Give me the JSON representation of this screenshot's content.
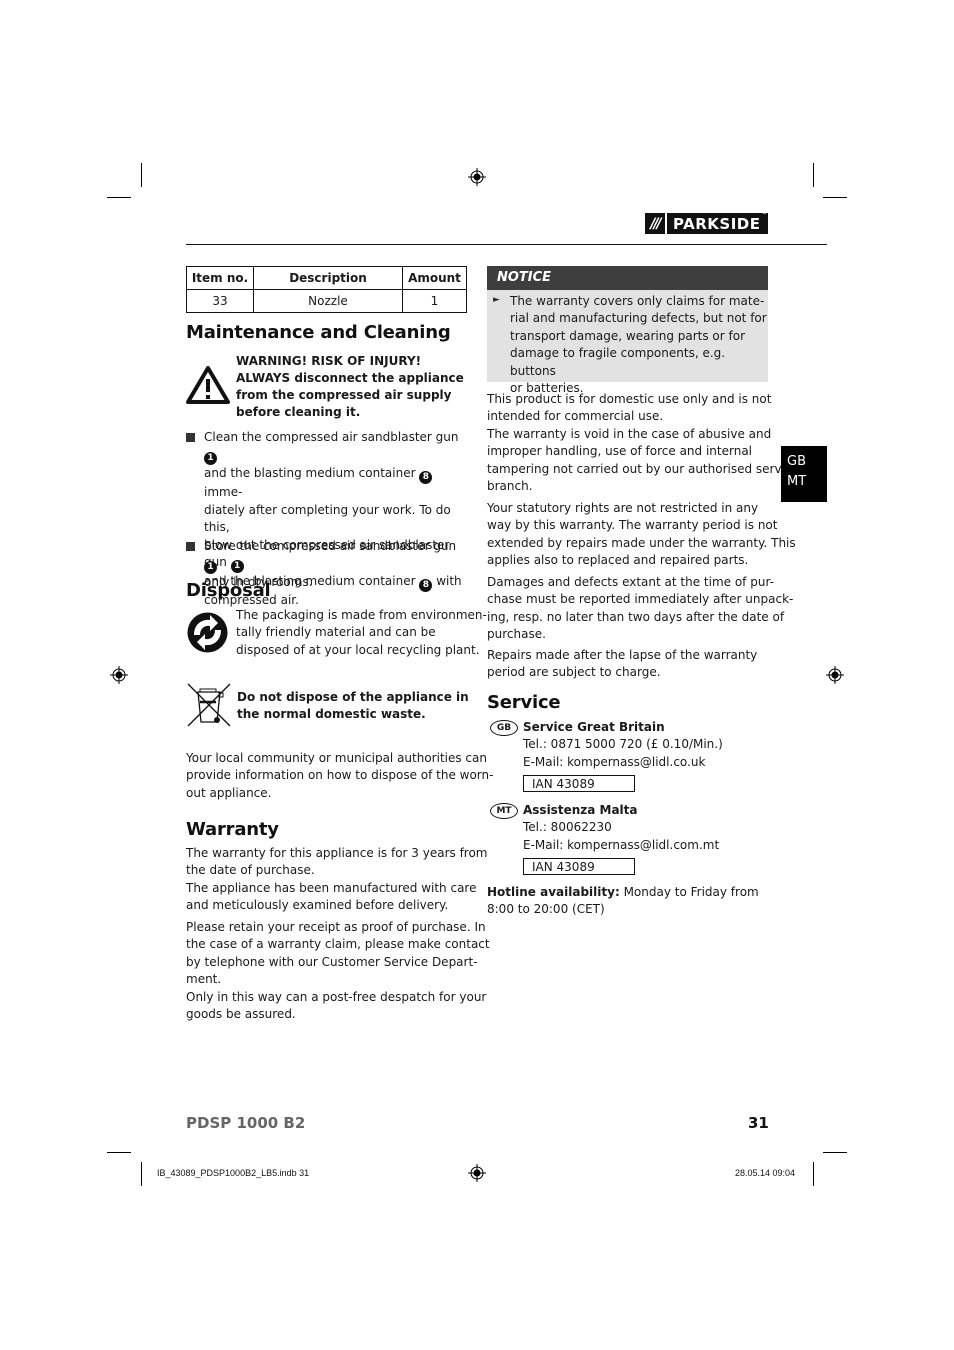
{
  "header": {
    "brand": "PARKSIDE",
    "brand_slashes": "///",
    "brand_registered": "®"
  },
  "parts_table": {
    "columns": [
      "Item no.",
      "Description",
      "Amount"
    ],
    "rows": [
      [
        "33",
        "Nozzle",
        "1"
      ]
    ]
  },
  "maintenance": {
    "title": "Maintenance and Cleaning",
    "warning_lines": [
      "WARNING! RISK OF INJURY!",
      "ALWAYS disconnect the appliance",
      "from the compressed air supply",
      "before cleaning it."
    ],
    "bullet1": {
      "lines": [
        "Clean the compressed air sandblaster gun",
        "and the blasting medium container",
        "imme-",
        "diately after completing your work. To do this,",
        "blow out the compressed air sandblaster gun",
        "and the blasting medium container",
        "with",
        "compressed air."
      ],
      "ref_gun": "1",
      "ref_container": "8"
    },
    "bullet2": {
      "lines": [
        "Store the compressed air sandblaster gun",
        "only in dry rooms."
      ],
      "ref_gun": "1"
    }
  },
  "disposal": {
    "title": "Disposal",
    "packaging_lines": [
      "The packaging is made from environmen-",
      "tally friendly material and can be",
      "disposed of at your local recycling plant."
    ],
    "weee_lines": [
      "Do not dispose of the appliance in",
      "the normal domestic waste."
    ],
    "info_lines": [
      "Your local community or municipal authorities can",
      "provide information on how to dispose of the worn-",
      "out appliance."
    ]
  },
  "warranty": {
    "title": "Warranty",
    "para1": [
      "The warranty for this appliance is for 3 years from",
      "the date of purchase.",
      "The appliance has been manufactured with care",
      "and meticulously examined before delivery."
    ],
    "para2": [
      "Please retain your receipt as proof of purchase. In",
      "the case of a warranty claim, please make contact",
      "by telephone with our Customer Service Depart-",
      "ment.",
      "Only in this way can a post-free despatch for your",
      "goods be assured."
    ]
  },
  "notice": {
    "title": "NOTICE",
    "lines": [
      "The warranty covers only claims for mate-",
      "rial and manufacturing defects, but not for",
      "transport damage, wearing parts or for",
      "damage to fragile components, e.g. buttons",
      "or batteries."
    ]
  },
  "right_col": {
    "para1": [
      "This product is for domestic use only and is not",
      "intended for commercial use.",
      "The warranty is void in the case of abusive and",
      "improper handling, use of force and internal",
      "tampering not carried out by our authorised service",
      "branch."
    ],
    "para2": [
      "Your statutory rights are not restricted in any",
      "way by this warranty. The warranty period is not",
      "extended by repairs made under the warranty. This",
      "applies also to replaced and repaired parts."
    ],
    "para3": [
      "Damages and defects extant at the time of pur-",
      "chase must be reported immediately after unpack-",
      "ing, resp. no later than two days after the date of",
      "purchase."
    ],
    "para4": [
      "Repairs made after the lapse of the warranty",
      "period are subject to charge."
    ]
  },
  "service": {
    "title": "Service",
    "gb": {
      "code": "GB",
      "name": "Service Great Britain",
      "tel": "Tel.: 0871 5000 720 (£ 0.10/Min.)",
      "email": "E-Mail: kompernass@lidl.co.uk",
      "ian": "IAN 43089"
    },
    "mt": {
      "code": "MT",
      "name": "Assistenza Malta",
      "tel": "Tel.: 80062230",
      "email": "E-Mail: kompernass@lidl.com.mt",
      "ian": "IAN 43089"
    },
    "hotline_label": "Hotline availability:",
    "hotline_text": " Monday to Friday from",
    "hotline_text2": "8:00 to 20:00 (CET)"
  },
  "side_tab": {
    "line1": "GB",
    "line2": "MT"
  },
  "footer": {
    "model": "PDSP 1000 B2",
    "page": "31",
    "slug_file": "IB_43089_PDSP1000B2_LB5.indb   31",
    "slug_date": "28.05.14   09:04"
  }
}
